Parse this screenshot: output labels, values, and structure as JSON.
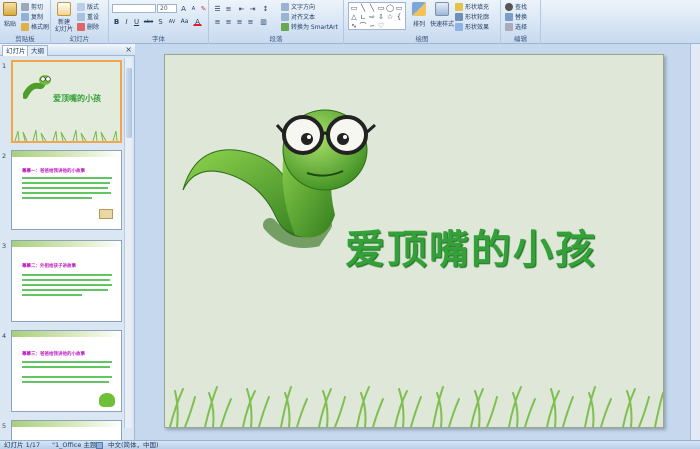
{
  "ribbon": {
    "clipboard": {
      "group_label": "剪贴板",
      "paste": "粘贴",
      "cut": "剪切",
      "copy": "复制",
      "format_painter": "格式刷"
    },
    "slides": {
      "group_label": "幻灯片",
      "new_slide": "新建\n幻灯片",
      "layout": "版式",
      "reset": "重设",
      "delete": "删除"
    },
    "font": {
      "group_label": "字体",
      "font_name": "",
      "font_size": "20",
      "bold": "B",
      "italic": "I",
      "underline": "U",
      "strike": "abe",
      "shadow": "S",
      "spacing": "AV",
      "case": "Aa",
      "color": "A"
    },
    "paragraph": {
      "group_label": "段落",
      "text_direction": "文字方向",
      "align_text": "对齐文本",
      "smartart": "转换为 SmartArt"
    },
    "drawing": {
      "group_label": "绘图",
      "arrange": "排列",
      "quick_styles": "快速样式",
      "shape_fill": "形状填充",
      "shape_outline": "形状轮廓",
      "shape_effects": "形状效果"
    },
    "editing": {
      "group_label": "编辑",
      "find": "查找",
      "replace": "替换",
      "select": "选择"
    }
  },
  "pane": {
    "tab_slides": "幻灯片",
    "tab_outline": "大纲",
    "close": "×",
    "thumbs": [
      {
        "num": "1",
        "title": "爱顶嘴的小孩"
      },
      {
        "num": "2",
        "title": "幕幕一：爸爸给我讲他的小故事"
      },
      {
        "num": "3",
        "title": "幕幕二：外祖给孩子讲故事"
      },
      {
        "num": "4",
        "title": "幕幕三：爸爸给我讲他的小故事"
      },
      {
        "num": "5",
        "title": ""
      }
    ]
  },
  "slide": {
    "title": "爱顶嘴的小孩"
  },
  "status": {
    "slide_info": "幻灯片 1/17",
    "theme": "\"1_Office 主题\"",
    "language": "中文(简体，中国)"
  },
  "colors": {
    "title_green": "#33a038",
    "accent_orange": "#f0a64d",
    "worm_green": "#5aae32"
  }
}
